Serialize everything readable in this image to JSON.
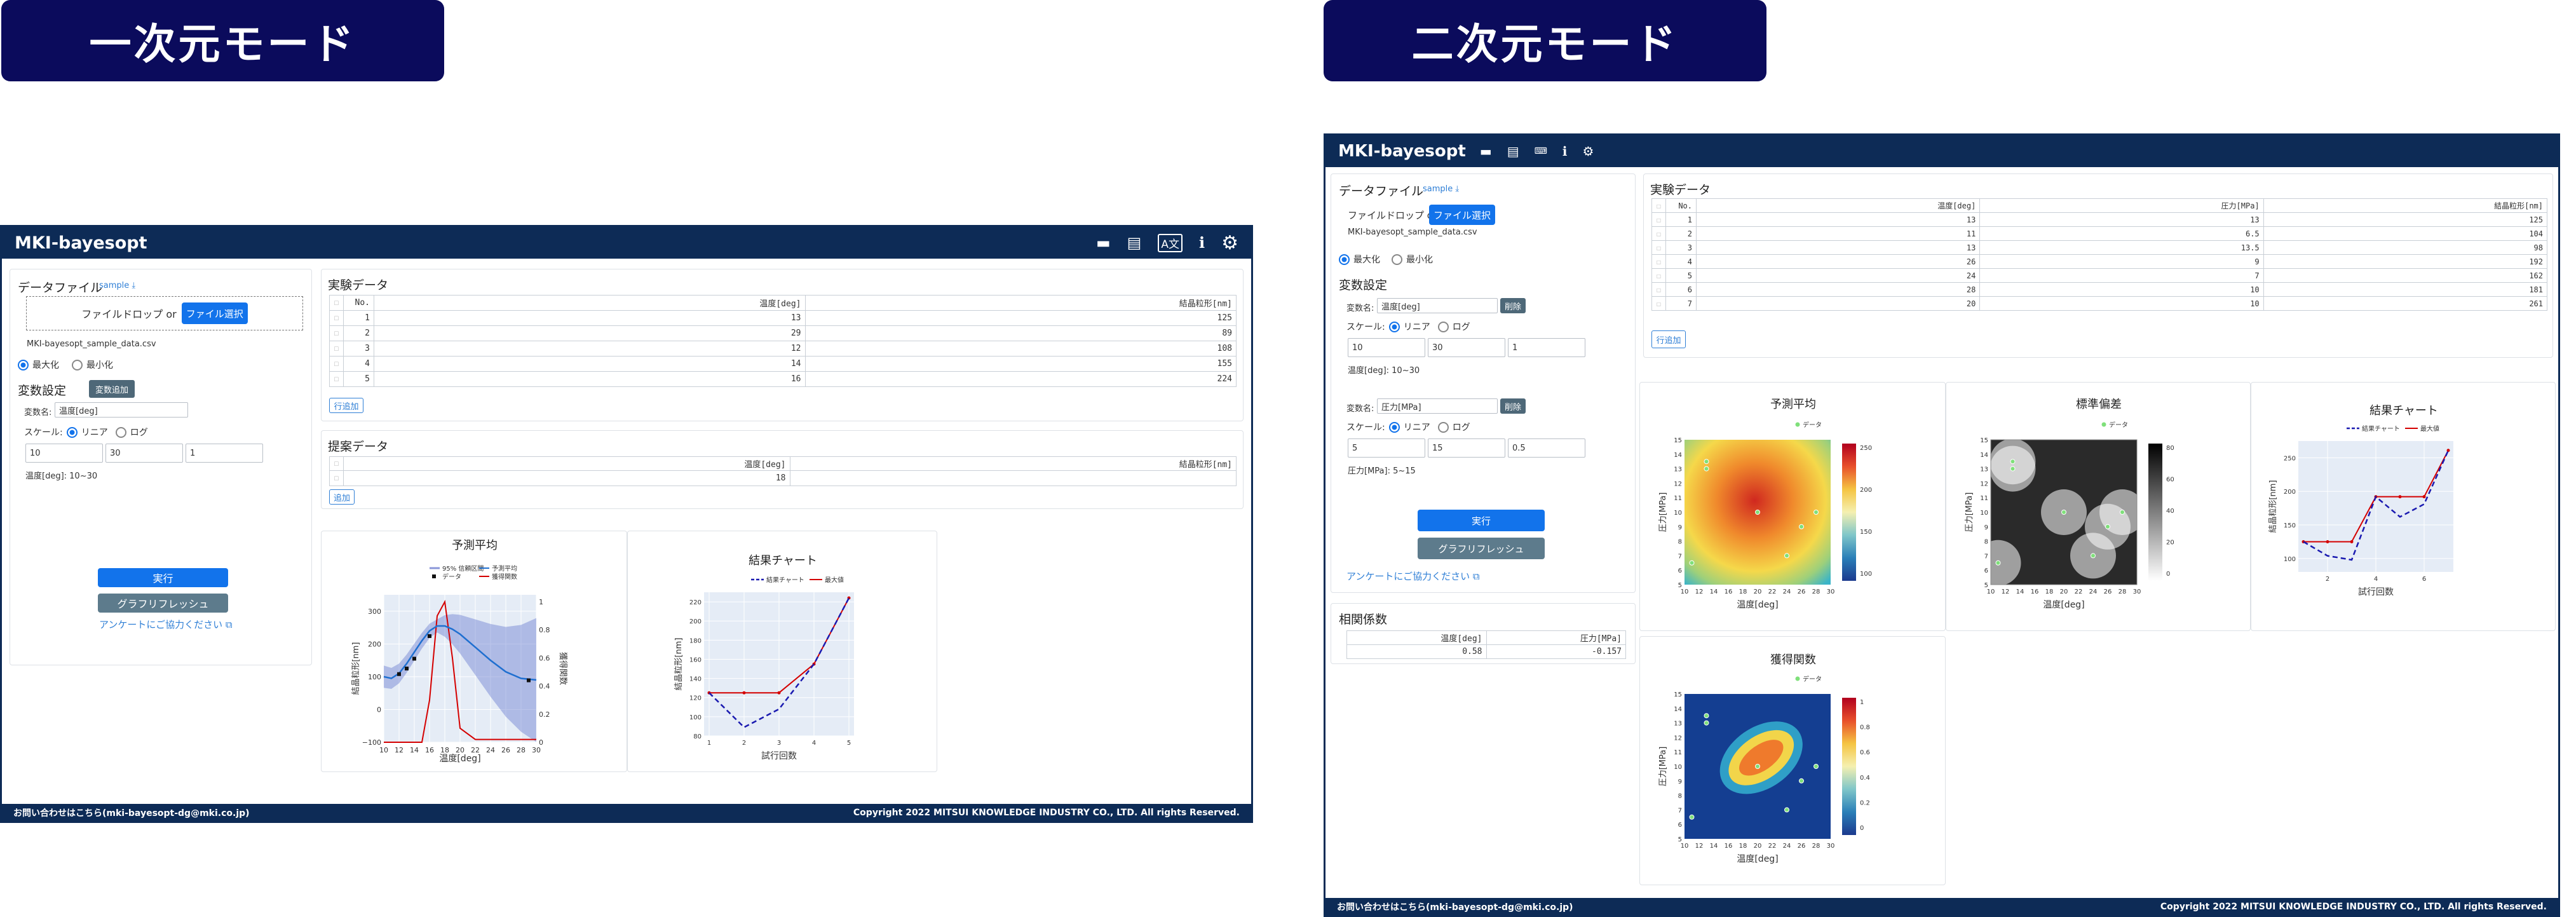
{
  "banners": {
    "left": "一次元モード",
    "right": "二次元モード"
  },
  "app_title": "MKI-bayesopt",
  "header_icons": [
    "book-icon",
    "file-icon",
    "translate-icon",
    "info-icon",
    "gear-icon"
  ],
  "left": {
    "data_file": {
      "label": "データファイル",
      "sample": "sample",
      "drop": "ファイルドロップ or",
      "select_button": "ファイル選択",
      "filename": "MKI-bayesopt_sample_data.csv"
    },
    "objective": {
      "maximize": "最大化",
      "minimize": "最小化",
      "selected": "maximize"
    },
    "variables": {
      "title": "変数設定",
      "add_button": "変数追加",
      "items": [
        {
          "name_label": "変数名:",
          "name_value": "温度[deg]",
          "scale_label": "スケール:",
          "linear": "リニア",
          "log": "ログ",
          "min": "10",
          "max": "30",
          "step": "1",
          "range_text": "温度[deg]: 10~30"
        }
      ]
    },
    "run_button": "実行",
    "refresh_button": "グラフリフレッシュ",
    "survey": "アンケートにご協力ください",
    "experiment": {
      "title": "実験データ",
      "columns": [
        "No.",
        "温度[deg]",
        "結晶粒形[nm]"
      ],
      "rows": [
        [
          "1",
          "13",
          "125"
        ],
        [
          "2",
          "29",
          "89"
        ],
        [
          "3",
          "12",
          "108"
        ],
        [
          "4",
          "14",
          "155"
        ],
        [
          "5",
          "16",
          "224"
        ]
      ],
      "add_row": "行追加"
    },
    "proposal": {
      "title": "提案データ",
      "columns": [
        "温度[deg]",
        "結晶粒形[nm]"
      ],
      "rows": [
        [
          "18",
          ""
        ]
      ],
      "add": "追加"
    },
    "charts": {
      "predict": {
        "title": "予測平均",
        "legend": [
          "95% 信頼区間",
          "予測平均",
          "データ",
          "獲得関数"
        ],
        "xlabel": "温度[deg]",
        "ylabel": "結晶粒形[nm]",
        "y2label": "獲得関数",
        "xticks": [
          "10",
          "12",
          "14",
          "16",
          "18",
          "20",
          "22",
          "24",
          "26",
          "28",
          "30"
        ],
        "yticks": [
          "−100",
          "0",
          "100",
          "200",
          "300"
        ],
        "y2ticks": [
          "0",
          "0.2",
          "0.4",
          "0.6",
          "0.8",
          "1"
        ]
      },
      "result": {
        "title": "結果チャート",
        "legend": [
          "結果チャート",
          "最大値"
        ],
        "xlabel": "試行回数",
        "ylabel": "結晶粒形[nm]",
        "xticks": [
          "1",
          "2",
          "3",
          "4",
          "5"
        ],
        "yticks": [
          "80",
          "100",
          "120",
          "140",
          "160",
          "180",
          "200",
          "220"
        ]
      }
    },
    "footer": {
      "contact": "お問い合わせはこちら(mki-bayesopt-dg@mki.co.jp)",
      "copyright": "Copyright 2022 MITSUI KNOWLEDGE INDUSTRY CO., LTD. All rights Reserved."
    }
  },
  "right": {
    "data_file": {
      "label": "データファイル",
      "sample": "sample",
      "drop": "ファイルドロップ or",
      "select_button": "ファイル選択",
      "filename": "MKI-bayesopt_sample_data.csv"
    },
    "objective": {
      "maximize": "最大化",
      "minimize": "最小化",
      "selected": "maximize"
    },
    "variables": {
      "title": "変数設定",
      "items": [
        {
          "name_label": "変数名:",
          "name_value": "温度[deg]",
          "delete": "削除",
          "scale_label": "スケール:",
          "linear": "リニア",
          "log": "ログ",
          "min": "10",
          "max": "30",
          "step": "1",
          "range_text": "温度[deg]: 10~30"
        },
        {
          "name_label": "変数名:",
          "name_value": "圧力[MPa]",
          "delete": "削除",
          "scale_label": "スケール:",
          "linear": "リニア",
          "log": "ログ",
          "min": "5",
          "max": "15",
          "step": "0.5",
          "range_text": "圧力[MPa]: 5~15"
        }
      ]
    },
    "run_button": "実行",
    "refresh_button": "グラフリフレッシュ",
    "survey": "アンケートにご協力ください",
    "correlation": {
      "title": "相関係数",
      "columns": [
        "温度[deg]",
        "圧力[MPa]"
      ],
      "values": [
        "0.58",
        "-0.157"
      ]
    },
    "experiment": {
      "title": "実験データ",
      "columns": [
        "No.",
        "温度[deg]",
        "圧力[MPa]",
        "結晶粒形[nm]"
      ],
      "rows": [
        [
          "1",
          "13",
          "13",
          "125"
        ],
        [
          "2",
          "11",
          "6.5",
          "104"
        ],
        [
          "3",
          "13",
          "13.5",
          "98"
        ],
        [
          "4",
          "26",
          "9",
          "192"
        ],
        [
          "5",
          "24",
          "7",
          "162"
        ],
        [
          "6",
          "28",
          "10",
          "181"
        ],
        [
          "7",
          "20",
          "10",
          "261"
        ]
      ],
      "add_row": "行追加"
    },
    "charts": {
      "predict": {
        "title": "予測平均",
        "legend": "データ",
        "xlabel": "温度[deg]",
        "ylabel": "圧力[MPa]",
        "cbticks": [
          "100",
          "150",
          "200",
          "250"
        ]
      },
      "std": {
        "title": "標準偏差",
        "legend": "データ",
        "xlabel": "温度[deg]",
        "ylabel": "圧力[MPa]",
        "cbticks": [
          "0",
          "20",
          "40",
          "60",
          "80"
        ]
      },
      "result": {
        "title": "結果チャート",
        "legend": [
          "結果チャート",
          "最大値"
        ],
        "xlabel": "試行回数",
        "ylabel": "結晶粒形[nm]",
        "yticks": [
          "100",
          "150",
          "200",
          "250"
        ],
        "xticks": [
          "2",
          "4",
          "6"
        ]
      },
      "acq": {
        "title": "獲得関数",
        "legend": "データ",
        "xlabel": "温度[deg]",
        "ylabel": "圧力[MPa]",
        "cbticks": [
          "0",
          "0.2",
          "0.4",
          "0.6",
          "0.8",
          "1"
        ]
      },
      "map_xticks": [
        "10",
        "12",
        "14",
        "16",
        "18",
        "20",
        "22",
        "24",
        "26",
        "28",
        "30"
      ],
      "map_yticks": [
        "5",
        "6",
        "7",
        "8",
        "9",
        "10",
        "11",
        "12",
        "13",
        "14",
        "15"
      ]
    },
    "footer": {
      "contact": "お問い合わせはこちら(mki-bayesopt-dg@mki.co.jp)",
      "copyright": "Copyright 2022 MITSUI KNOWLEDGE INDUSTRY CO., LTD. All rights Reserved."
    }
  },
  "chart_data": [
    {
      "type": "line",
      "title": "予測平均",
      "xlabel": "温度[deg]",
      "ylabel": "結晶粒形[nm]",
      "xlim": [
        10,
        30
      ],
      "ylim": [
        -100,
        350
      ],
      "series": [
        {
          "name": "予測平均",
          "x": [
            10,
            11,
            12,
            13,
            14,
            15,
            16,
            17,
            18,
            19,
            20,
            22,
            24,
            26,
            28,
            30
          ],
          "values": [
            100,
            95,
            110,
            140,
            175,
            210,
            240,
            255,
            255,
            245,
            230,
            190,
            150,
            115,
            95,
            90
          ]
        },
        {
          "name": "データ",
          "x": [
            12,
            13,
            14,
            16,
            29
          ],
          "values": [
            108,
            125,
            155,
            224,
            89
          ]
        },
        {
          "name": "獲得関数",
          "x": [
            10,
            14,
            15,
            16,
            17,
            18,
            19,
            20,
            22,
            24,
            26,
            28,
            30
          ],
          "values": [
            0,
            0,
            0,
            0.3,
            0.9,
            1.0,
            0.6,
            0.1,
            0.02,
            0.02,
            0.02,
            0.02,
            0.02
          ]
        }
      ]
    },
    {
      "type": "line",
      "title": "結果チャート",
      "xlabel": "試行回数",
      "ylabel": "結晶粒形[nm]",
      "ylim": [
        80,
        230
      ],
      "categories": [
        "1",
        "2",
        "3",
        "4",
        "5"
      ],
      "series": [
        {
          "name": "結果チャート",
          "values": [
            125,
            89,
            108,
            155,
            224
          ]
        },
        {
          "name": "最大値",
          "values": [
            125,
            125,
            125,
            155,
            224
          ]
        }
      ]
    },
    {
      "type": "heatmap",
      "title": "予測平均",
      "xlabel": "温度[deg]",
      "ylabel": "圧力[MPa]",
      "xlim": [
        10,
        30
      ],
      "ylim": [
        5,
        15
      ],
      "series": [
        {
          "name": "データ",
          "x": [
            13,
            11,
            13,
            26,
            24,
            28,
            20
          ],
          "y": [
            13,
            6.5,
            13.5,
            9,
            7,
            10,
            10
          ]
        }
      ]
    },
    {
      "type": "heatmap",
      "title": "標準偏差",
      "xlabel": "温度[deg]",
      "ylabel": "圧力[MPa]",
      "xlim": [
        10,
        30
      ],
      "ylim": [
        5,
        15
      ],
      "series": [
        {
          "name": "データ",
          "x": [
            13,
            11,
            13,
            26,
            24,
            28,
            20
          ],
          "y": [
            13,
            6.5,
            13.5,
            9,
            7,
            10,
            10
          ]
        }
      ]
    },
    {
      "type": "line",
      "title": "結果チャート",
      "xlabel": "試行回数",
      "ylabel": "結晶粒形[nm]",
      "categories": [
        "1",
        "2",
        "3",
        "4",
        "5",
        "6",
        "7"
      ],
      "series": [
        {
          "name": "結果チャート",
          "values": [
            125,
            104,
            98,
            192,
            162,
            181,
            261
          ]
        },
        {
          "name": "最大値",
          "values": [
            125,
            125,
            125,
            192,
            192,
            192,
            261
          ]
        }
      ]
    },
    {
      "type": "heatmap",
      "title": "獲得関数",
      "xlabel": "温度[deg]",
      "ylabel": "圧力[MPa]",
      "xlim": [
        10,
        30
      ],
      "ylim": [
        5,
        15
      ],
      "series": [
        {
          "name": "データ",
          "x": [
            13,
            11,
            13,
            26,
            24,
            28,
            20
          ],
          "y": [
            13,
            6.5,
            13.5,
            9,
            7,
            10,
            10
          ]
        }
      ]
    }
  ]
}
